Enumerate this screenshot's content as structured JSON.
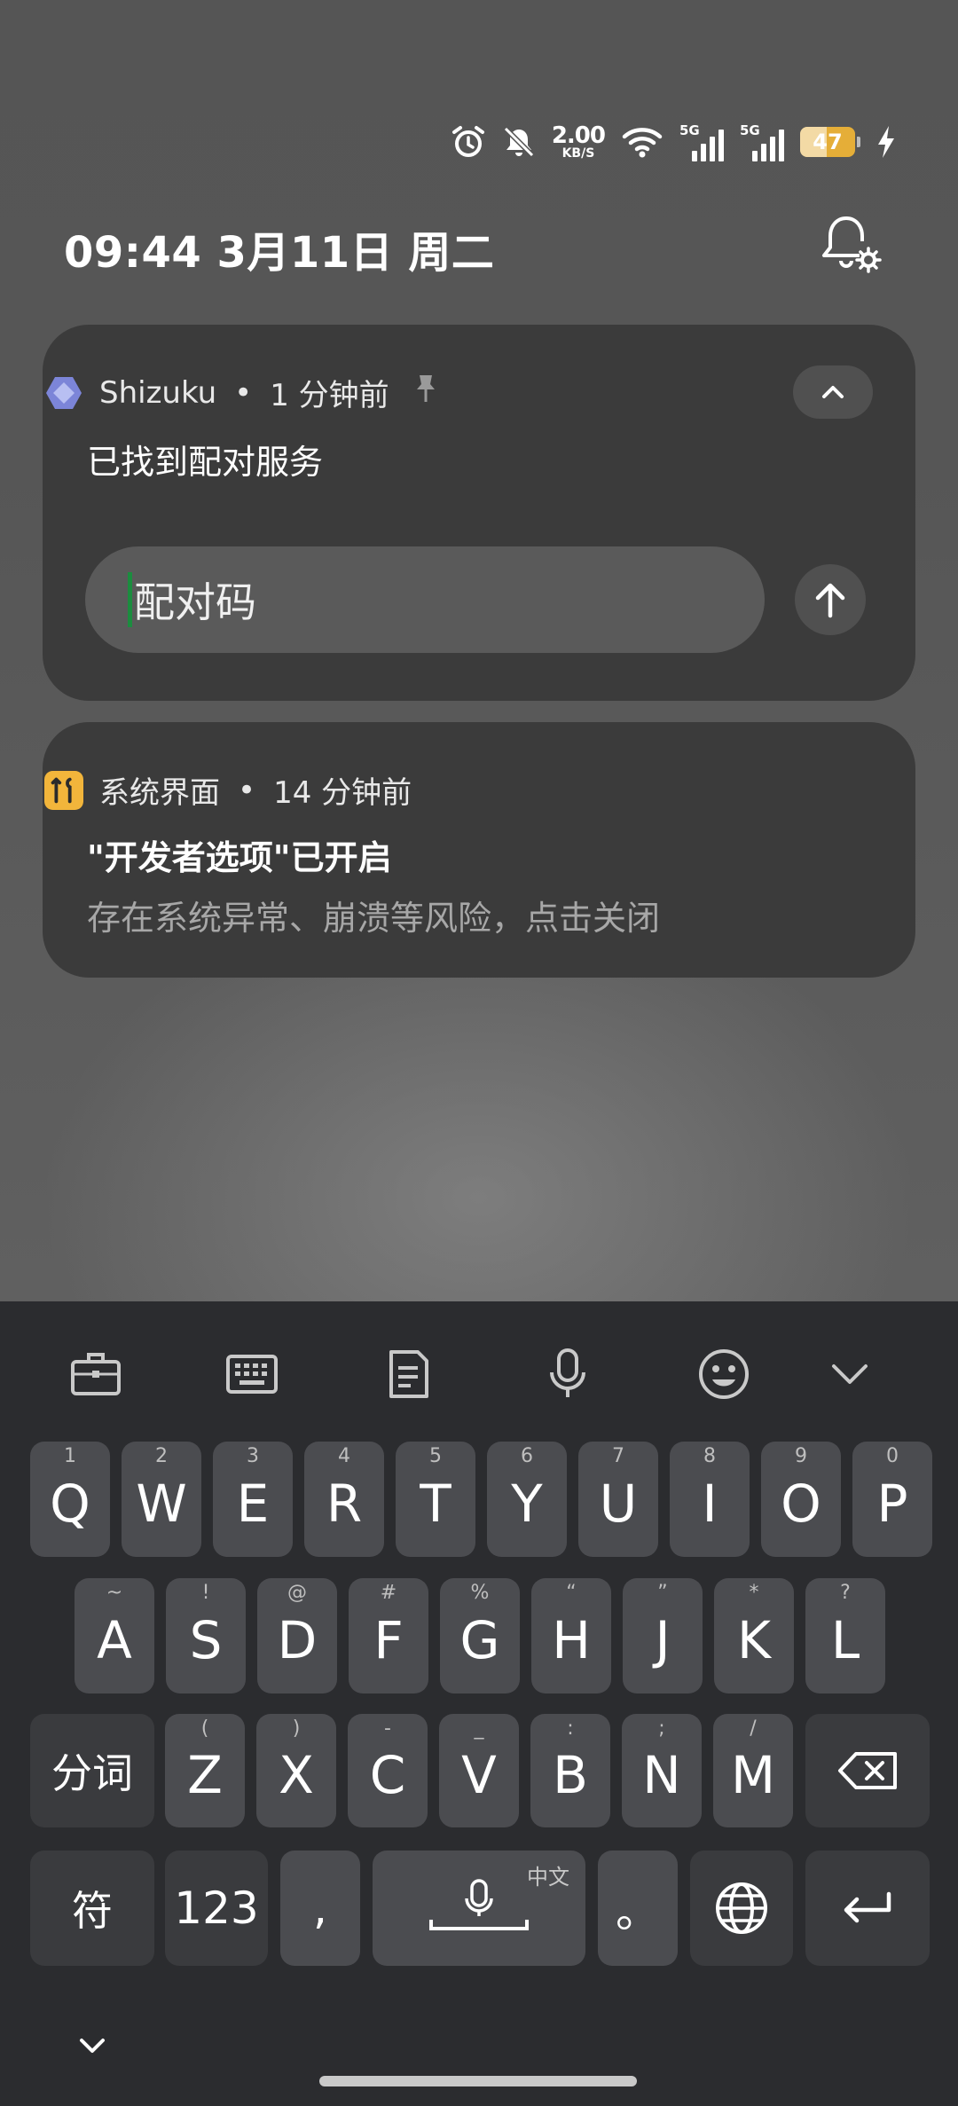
{
  "status_bar": {
    "alarm_icon": "alarm-clock-icon",
    "silent_icon": "bell-off-icon",
    "net_speed_value": "2.00",
    "net_speed_unit": "KB/S",
    "wifi_icon": "wifi-icon",
    "sim1_tag": "5G",
    "sim2_tag": "5G",
    "battery_level": "47",
    "battery_color": "#e5ae38",
    "charging_icon": "lightning-bolt-icon"
  },
  "header": {
    "datetime": "09:44  3月11日 周二",
    "notification_settings_icon": "bell-settings-icon"
  },
  "notifications": [
    {
      "app_name": "Shizuku",
      "separator": "•",
      "time": "1 分钟前",
      "pin_icon": "pin-icon",
      "title": "已找到配对服务",
      "input_placeholder": "配对码",
      "send_icon": "arrow-up-icon",
      "collapse_icon": "chevron-up-icon"
    },
    {
      "app_name": "系统界面",
      "separator": "•",
      "time": "14 分钟前",
      "title": "\"开发者选项\"已开启",
      "text": "存在系统异常、崩溃等风险，点击关闭",
      "app_icon_color": "#f2b53b"
    }
  ],
  "keyboard": {
    "toolbar": [
      "briefcase-icon",
      "keyboard-icon",
      "clipboard-icon",
      "microphone-icon",
      "emoji-icon",
      "chevron-down-icon"
    ],
    "row1": [
      {
        "key": "Q",
        "hint": "1"
      },
      {
        "key": "W",
        "hint": "2"
      },
      {
        "key": "E",
        "hint": "3"
      },
      {
        "key": "R",
        "hint": "4"
      },
      {
        "key": "T",
        "hint": "5"
      },
      {
        "key": "Y",
        "hint": "6"
      },
      {
        "key": "U",
        "hint": "7"
      },
      {
        "key": "I",
        "hint": "8"
      },
      {
        "key": "O",
        "hint": "9"
      },
      {
        "key": "P",
        "hint": "0"
      }
    ],
    "row2": [
      {
        "key": "A",
        "hint": "~"
      },
      {
        "key": "S",
        "hint": "!"
      },
      {
        "key": "D",
        "hint": "@"
      },
      {
        "key": "F",
        "hint": "#"
      },
      {
        "key": "G",
        "hint": "%"
      },
      {
        "key": "H",
        "hint": "“"
      },
      {
        "key": "J",
        "hint": "”"
      },
      {
        "key": "K",
        "hint": "*"
      },
      {
        "key": "L",
        "hint": "?"
      }
    ],
    "row3": [
      {
        "key": "Z",
        "hint": "("
      },
      {
        "key": "X",
        "hint": ")"
      },
      {
        "key": "C",
        "hint": "-"
      },
      {
        "key": "V",
        "hint": "_"
      },
      {
        "key": "B",
        "hint": ":"
      },
      {
        "key": "N",
        "hint": ";"
      },
      {
        "key": "M",
        "hint": "/"
      }
    ],
    "fenci_label": "分词",
    "backspace_icon": "backspace-icon",
    "symbol_label": "符",
    "number_label": "123",
    "comma_label": ",",
    "space_lang_label": "中文",
    "space_mic_icon": "microphone-icon",
    "period_label": "。",
    "globe_icon": "globe-icon",
    "enter_icon": "enter-return-icon",
    "hide_keyboard_icon": "chevron-down-icon"
  }
}
